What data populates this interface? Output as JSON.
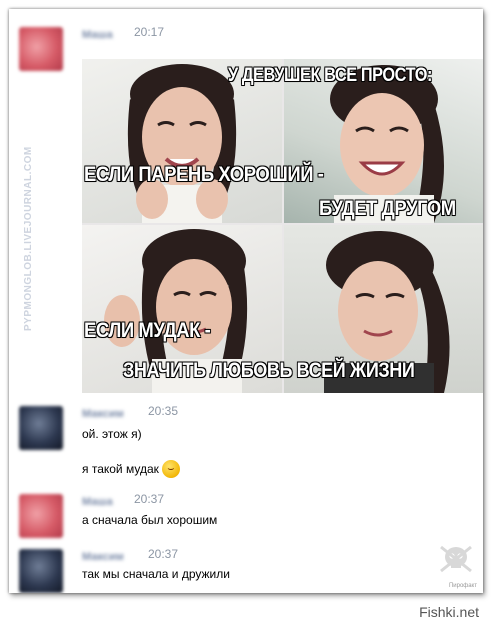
{
  "watermark": "PYPMONGLOB.LIVEJOURNAL.COM",
  "posts": [
    {
      "name": "Маша",
      "time": "20:17",
      "avatar": "pink"
    },
    {
      "name": "Максим",
      "time": "20:35",
      "lines": [
        "ой. этож я)",
        "я такой мудак"
      ],
      "emoji": "laughing-face"
    },
    {
      "name": "Маша",
      "time": "20:37",
      "lines": [
        "а сначала был хорошим"
      ]
    },
    {
      "name": "Максим",
      "time": "20:37",
      "lines": [
        "так мы сначала и дружили"
      ]
    }
  ],
  "meme": {
    "captions": {
      "top": "У ДЕВУШЕК ВСЕ ПРОСТО:",
      "good_1": "ЕСЛИ ПАРЕНЬ ХОРОШИЙ -",
      "good_2": "БУДЕТ ДРУГОМ",
      "bad_1": "ЕСЛИ МУДАК -",
      "bad_2": "ЗНАЧИТЬ ЛЮБОВЬ ВСЕЙ ЖИЗНИ"
    }
  },
  "corner_logo_label": "Пирофакт",
  "credit": "Fishki.net"
}
